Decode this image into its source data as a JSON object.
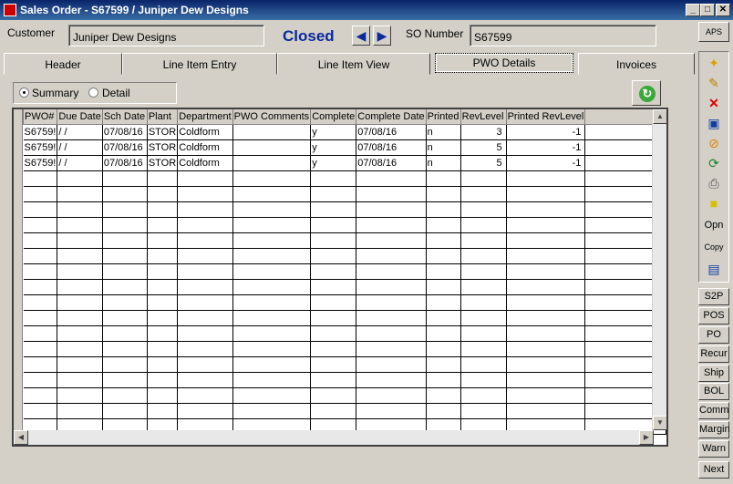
{
  "window": {
    "title": "Sales Order - S67599 / Juniper Dew Designs",
    "minimize": "_",
    "restore": "□",
    "close": "✕"
  },
  "header": {
    "customer_label": "Customer",
    "customer_value": "Juniper Dew Designs",
    "status": "Closed",
    "so_label": "SO Number",
    "so_value": "S67599",
    "aps": "APS"
  },
  "tabs": [
    {
      "label": "Header"
    },
    {
      "label": "Line Item Entry"
    },
    {
      "label": "Line Item View"
    },
    {
      "label": "PWO Details"
    },
    {
      "label": "Invoices"
    }
  ],
  "view": {
    "summary": "Summary",
    "detail": "Detail"
  },
  "grid": {
    "columns": [
      "PWO#",
      "Due Date",
      "Sch Date",
      "Plant",
      "Department",
      "PWO Comments",
      "Complete",
      "Complete Date",
      "Printed",
      "RevLevel",
      "Printed RevLevel"
    ],
    "rows": [
      [
        "S6759!",
        "/ /",
        "07/08/16",
        "STOR",
        "Coldform",
        "",
        "y",
        "07/08/16",
        "n",
        "3",
        "-1"
      ],
      [
        "S6759!",
        "/ /",
        "07/08/16",
        "STOR",
        "Coldform",
        "",
        "y",
        "07/08/16",
        "n",
        "5",
        "-1"
      ],
      [
        "S6759!",
        "/ /",
        "07/08/16",
        "STOR",
        "Coldform",
        "",
        "y",
        "07/08/16",
        "n",
        "5",
        "-1"
      ]
    ]
  },
  "toolbar": {
    "open": "Opn",
    "copy": "Copy"
  },
  "side_buttons": [
    "S2P",
    "POS",
    "PO",
    "Recur",
    "Ship",
    "BOL",
    "Comm",
    "Margin",
    "Warn",
    "Next"
  ],
  "icons": {
    "new": "new-doc-icon",
    "edit": "edit-icon",
    "delete": "delete-icon",
    "save": "save-icon",
    "cancel": "cancel-icon",
    "refresh": "refresh-icon",
    "print": "print-icon",
    "note": "note-icon",
    "image": "image-icon"
  }
}
